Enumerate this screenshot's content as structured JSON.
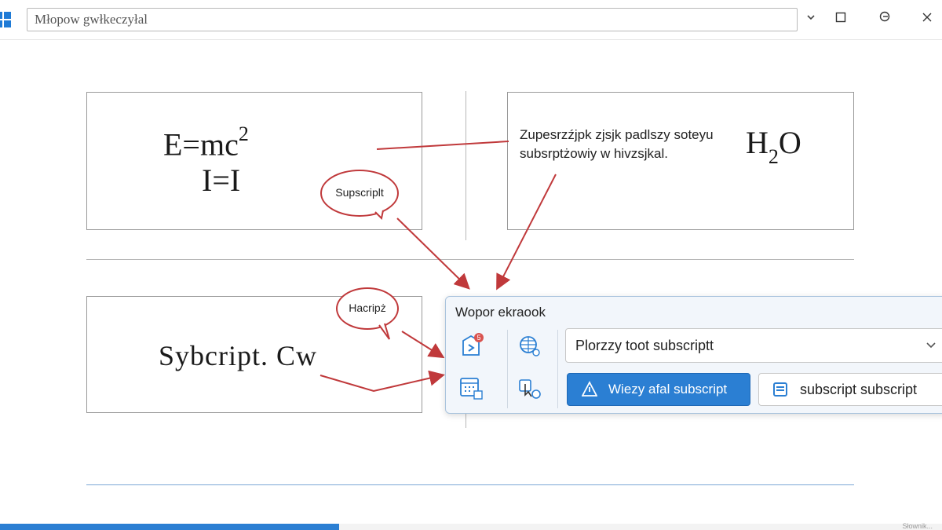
{
  "window": {
    "title_value": "Młopow gwłkeczyłal",
    "buttons": {
      "dropdown_icon": "chevron-down-icon",
      "maximize_icon": "maximize-icon",
      "restore_icon": "restore-icon",
      "close_icon": "close-icon"
    }
  },
  "document": {
    "panel_top_left": {
      "formula_main": "E=mc",
      "formula_exponent": "2",
      "formula_second": "I=I"
    },
    "panel_top_right": {
      "note_line1": "Zupesrzźjpk zjsjk padlszy soteyu",
      "note_line2": "subsrptżowiy w hivzsjkal.",
      "formula_main": "H",
      "formula_subscript": "2",
      "formula_end": "O"
    },
    "panel_bottom_left": {
      "text": "Sybcript. Cw"
    },
    "callouts": {
      "bubble1": "Supscriplt",
      "bubble2": "Hacripż"
    }
  },
  "toolbar_popup": {
    "title": "Wopor ekraook",
    "combo_value": "Plorzzy toot subscriptt",
    "primary_button": "Wiezy afal subscript",
    "secondary_button": "subscript  subscript",
    "icons": [
      "document-badge-icon",
      "table-globe-icon",
      "calendar-grid-icon",
      "cursor-settings-icon"
    ],
    "badge_count": "5"
  },
  "status": {
    "progress_fraction": 0.36,
    "text": "Słownik..."
  },
  "colors": {
    "accent": "#2b7fd3",
    "callout": "#c0393b"
  }
}
